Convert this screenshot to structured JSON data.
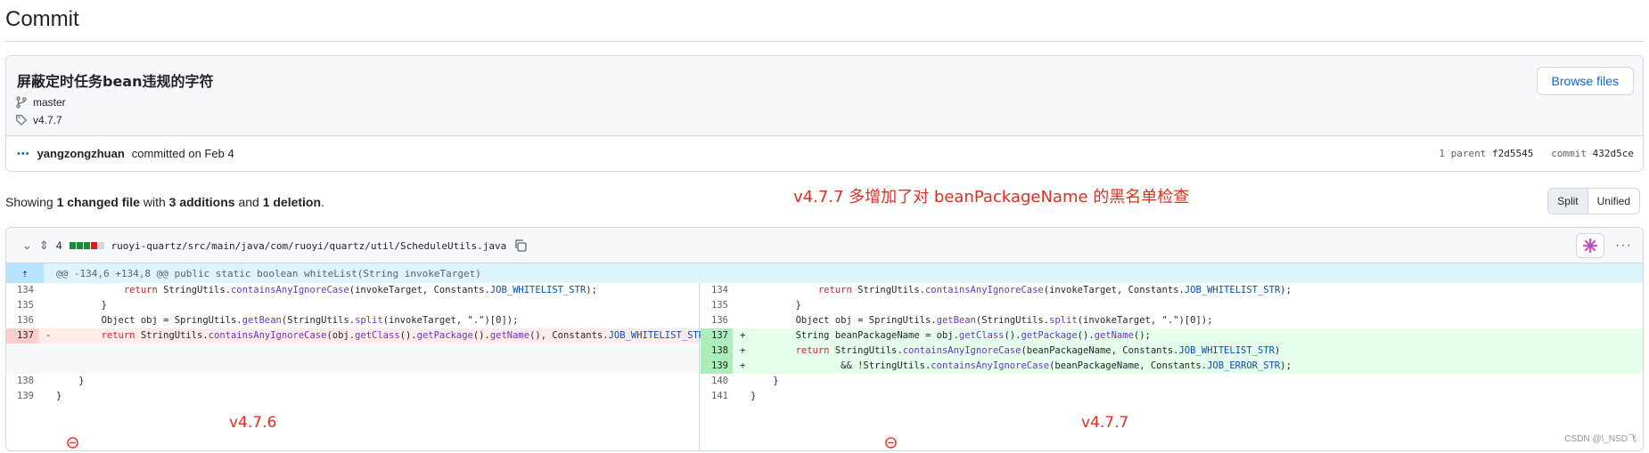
{
  "page": {
    "title": "Commit"
  },
  "commit": {
    "message": "屏蔽定时任务bean违规的字符",
    "branch": "master",
    "tag": "v4.7.7",
    "browse_label": "Browse files",
    "author": "yangzongzhuan",
    "committed_text": "committed on Feb 4",
    "parent_label": "1 parent",
    "parent_sha": "f2d5545",
    "commit_label": "commit",
    "commit_sha": "432d5ce"
  },
  "summary": {
    "prefix": "Showing",
    "changed": "1 changed file",
    "with": "with",
    "additions": "3 additions",
    "and": "and",
    "deletions": "1 deletion",
    "suffix": "."
  },
  "annotations": {
    "top": "v4.7.7 多增加了对 beanPackageName 的黑名单检查",
    "left_version": "v4.7.6",
    "right_version": "v4.7.7"
  },
  "view_toggle": {
    "split": "Split",
    "unified": "Unified"
  },
  "file": {
    "changes": "4",
    "path": "ruoyi-quartz/src/main/java/com/ruoyi/quartz/util/ScheduleUtils.java",
    "hunk_header": "@@ -134,6 +134,8 @@ public static boolean whiteList(String invokeTarget)"
  },
  "diff": {
    "left": [
      {
        "num": "134",
        "type": "ctx",
        "mark": "",
        "code": "            return StringUtils.containsAnyIgnoreCase(invokeTarget, Constants.JOB_WHITELIST_STR);"
      },
      {
        "num": "135",
        "type": "ctx",
        "mark": "",
        "code": "        }"
      },
      {
        "num": "136",
        "type": "ctx",
        "mark": "",
        "code": "        Object obj = SpringUtils.getBean(StringUtils.split(invokeTarget, \".\")[0]);"
      },
      {
        "num": "137",
        "type": "del",
        "mark": "-",
        "code": "        return StringUtils.containsAnyIgnoreCase(obj.getClass().getPackage().getName(), Constants.JOB_WHITELIST_STR);"
      },
      {
        "num": "",
        "type": "empty",
        "mark": "",
        "code": ""
      },
      {
        "num": "",
        "type": "empty",
        "mark": "",
        "code": ""
      },
      {
        "num": "138",
        "type": "ctx",
        "mark": "",
        "code": "    }"
      },
      {
        "num": "139",
        "type": "ctx",
        "mark": "",
        "code": "}"
      }
    ],
    "right": [
      {
        "num": "134",
        "type": "ctx",
        "mark": "",
        "code": "            return StringUtils.containsAnyIgnoreCase(invokeTarget, Constants.JOB_WHITELIST_STR);"
      },
      {
        "num": "135",
        "type": "ctx",
        "mark": "",
        "code": "        }"
      },
      {
        "num": "136",
        "type": "ctx",
        "mark": "",
        "code": "        Object obj = SpringUtils.getBean(StringUtils.split(invokeTarget, \".\")[0]);"
      },
      {
        "num": "137",
        "type": "add",
        "mark": "+",
        "code": "        String beanPackageName = obj.getClass().getPackage().getName();"
      },
      {
        "num": "138",
        "type": "add",
        "mark": "+",
        "code": "        return StringUtils.containsAnyIgnoreCase(beanPackageName, Constants.JOB_WHITELIST_STR)"
      },
      {
        "num": "139",
        "type": "add",
        "mark": "+",
        "code": "                && !StringUtils.containsAnyIgnoreCase(beanPackageName, Constants.JOB_ERROR_STR);"
      },
      {
        "num": "140",
        "type": "ctx",
        "mark": "",
        "code": "    }"
      },
      {
        "num": "141",
        "type": "ctx",
        "mark": "",
        "code": "}"
      }
    ]
  },
  "watermark": "CSDN @\\_NSD飞",
  "icons": [
    "branch-icon",
    "tag-icon",
    "commits-dots-icon",
    "chevron-down-icon",
    "expand-icon",
    "copy-icon",
    "sparkle-icon",
    "kebab-icon",
    "expand-up-icon",
    "minus-circle-icon"
  ],
  "colors": {
    "added_bg": "#e6ffec",
    "added_gutter": "#aceebb",
    "deleted_bg": "#ffebe9",
    "deleted_gutter": "#ffcecb",
    "hunk_bg": "#ddf4ff",
    "annotation_red": "#e0301e",
    "link_blue": "#0969da"
  }
}
